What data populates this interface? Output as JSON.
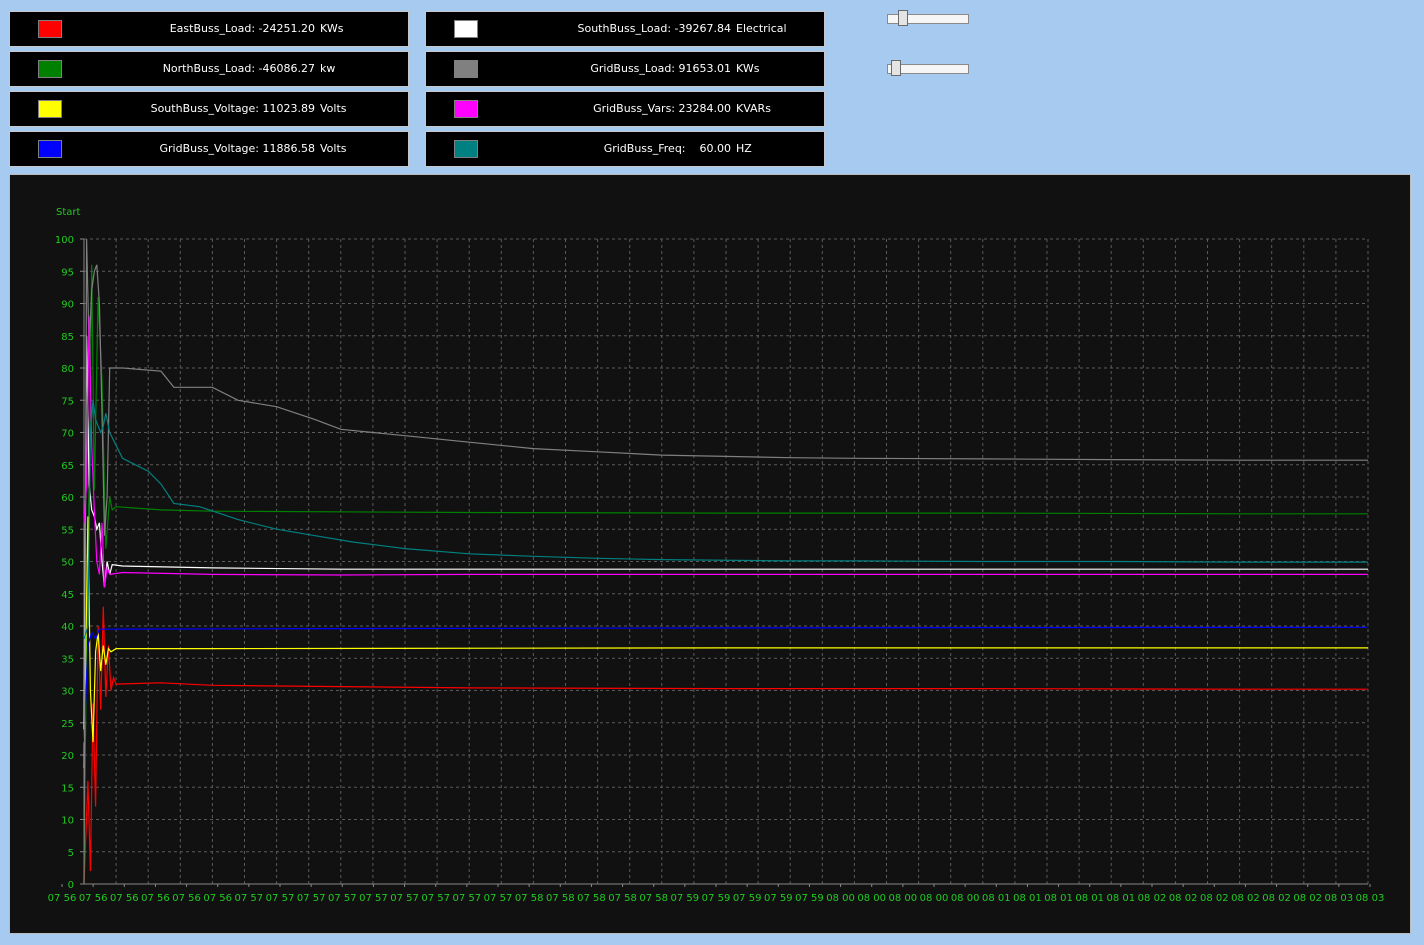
{
  "legend": [
    {
      "label": "EastBuss_Load: -24251.20",
      "unit": "KWs",
      "color": "#ff0000"
    },
    {
      "label": "NorthBuss_Load: -46086.27",
      "unit": "kw",
      "color": "#008000"
    },
    {
      "label": "SouthBuss_Voltage: 11023.89",
      "unit": "Volts",
      "color": "#ffff00"
    },
    {
      "label": "GridBuss_Voltage: 11886.58",
      "unit": "Volts",
      "color": "#0000ff"
    },
    {
      "label": "SouthBuss_Load: -39267.84",
      "unit": "Electrical",
      "color": "#ffffff"
    },
    {
      "label": "GridBuss_Load: 91653.01",
      "unit": "KWs",
      "color": "#808080"
    },
    {
      "label": "GridBuss_Vars: 23284.00",
      "unit": "KVARs",
      "color": "#ff00ff"
    },
    {
      "label": "GridBuss_Freq:    60.00",
      "unit": "HZ",
      "color": "#008080"
    }
  ],
  "sliders": [
    {
      "value": 0.15
    },
    {
      "value": 0.06
    }
  ],
  "chart_data": {
    "type": "line",
    "annotation": "Start",
    "ylim": [
      0,
      100
    ],
    "yticks": [
      0,
      5,
      10,
      15,
      20,
      25,
      30,
      35,
      40,
      45,
      50,
      55,
      60,
      65,
      70,
      75,
      80,
      85,
      90,
      95,
      100
    ],
    "grid": true,
    "xlim": [
      0,
      1
    ],
    "xticks": [
      {
        "x": 0.0,
        "label": "07 56"
      },
      {
        "x": 0.0205,
        "label": "07 56"
      },
      {
        "x": 0.0466,
        "label": "07 56"
      },
      {
        "x": 0.0729,
        "label": "07 56"
      },
      {
        "x": 0.0995,
        "label": "07 56"
      },
      {
        "x": 0.1256,
        "label": "07 56"
      },
      {
        "x": 0.1528,
        "label": "07 57"
      },
      {
        "x": 0.1787,
        "label": "07 57"
      },
      {
        "x": 0.2034,
        "label": "07 57"
      },
      {
        "x": 0.2274,
        "label": "07 57"
      },
      {
        "x": 0.2528,
        "label": "07 57"
      },
      {
        "x": 0.259,
        "label": "07 57"
      },
      {
        "x": 0.3134,
        "label": "07 57"
      },
      {
        "x": 0.3232,
        "label": "07 57"
      },
      {
        "x": 0.3472,
        "label": "07 57"
      },
      {
        "x": 0.3743,
        "label": "07 58"
      },
      {
        "x": 0.4006,
        "label": "07 58"
      },
      {
        "x": 0.4263,
        "label": "07 58"
      },
      {
        "x": 0.4827,
        "label": "07 58"
      },
      {
        "x": 0.5087,
        "label": "07 58"
      },
      {
        "x": 0.5354,
        "label": "07 59"
      },
      {
        "x": 0.5624,
        "label": "07 59"
      },
      {
        "x": 0.6156,
        "label": "07 59"
      },
      {
        "x": 0.6419,
        "label": "07 59"
      },
      {
        "x": 0.6681,
        "label": "07 59"
      },
      {
        "x": 0.695,
        "label": "08 00"
      },
      {
        "x": 0.7207,
        "label": "08 00"
      },
      {
        "x": 0.7467,
        "label": "08 00"
      },
      {
        "x": 0.7728,
        "label": "08 00"
      },
      {
        "x": 0.7991,
        "label": "08 00"
      },
      {
        "x": 0.8241,
        "label": "08 01"
      },
      {
        "x": 0.8482,
        "label": "08 01"
      },
      {
        "x": 0.8714,
        "label": "08 01"
      },
      {
        "x": 0.923,
        "label": "08 01"
      },
      {
        "x": 0.9476,
        "label": "08 01"
      },
      {
        "x": 0.9717,
        "label": "08 02"
      },
      {
        "x": 0.9972,
        "label": "08 02"
      },
      {
        "x": 1.022,
        "label": "08 02"
      },
      {
        "x": 1.0462,
        "label": "08 02"
      },
      {
        "x": 1.1012,
        "label": "08 02"
      },
      {
        "x": 1.1255,
        "label": "08 02"
      },
      {
        "x": 1.15,
        "label": "08 03"
      },
      {
        "x": 1.1741,
        "label": "08 03"
      }
    ],
    "series": [
      {
        "name": "EastBuss_Load",
        "color": "#ff0000",
        "points": [
          [
            0,
            0
          ],
          [
            0.003,
            16
          ],
          [
            0.005,
            2
          ],
          [
            0.007,
            28
          ],
          [
            0.009,
            12
          ],
          [
            0.011,
            40
          ],
          [
            0.013,
            27
          ],
          [
            0.015,
            43
          ],
          [
            0.017,
            29
          ],
          [
            0.019,
            37
          ],
          [
            0.021,
            30
          ],
          [
            0.023,
            32
          ],
          [
            0.025,
            31
          ],
          [
            0.06,
            31.2
          ],
          [
            0.1,
            30.8
          ],
          [
            0.2,
            30.6
          ],
          [
            0.3,
            30.4
          ],
          [
            0.5,
            30.3
          ],
          [
            0.7,
            30.3
          ],
          [
            0.9,
            30.2
          ],
          [
            1,
            30.2
          ]
        ]
      },
      {
        "name": "NorthBuss_Load",
        "color": "#008000",
        "points": [
          [
            0,
            0
          ],
          [
            0.002,
            40
          ],
          [
            0.004,
            62
          ],
          [
            0.006,
            96
          ],
          [
            0.008,
            61
          ],
          [
            0.011,
            91
          ],
          [
            0.014,
            78
          ],
          [
            0.017,
            52
          ],
          [
            0.02,
            60
          ],
          [
            0.022,
            58
          ],
          [
            0.025,
            58.5
          ],
          [
            0.06,
            58
          ],
          [
            0.1,
            57.8
          ],
          [
            0.3,
            57.6
          ],
          [
            0.5,
            57.5
          ],
          [
            0.7,
            57.5
          ],
          [
            0.9,
            57.4
          ],
          [
            1,
            57.4
          ]
        ]
      },
      {
        "name": "SouthBuss_Voltage",
        "color": "#ffff00",
        "points": [
          [
            0,
            18
          ],
          [
            0.003,
            57
          ],
          [
            0.005,
            30
          ],
          [
            0.007,
            22
          ],
          [
            0.009,
            36
          ],
          [
            0.011,
            39
          ],
          [
            0.013,
            33
          ],
          [
            0.015,
            37
          ],
          [
            0.017,
            34
          ],
          [
            0.019,
            36.5
          ],
          [
            0.021,
            36
          ],
          [
            0.025,
            36.5
          ],
          [
            0.1,
            36.5
          ],
          [
            0.5,
            36.6
          ],
          [
            1,
            36.6
          ]
        ]
      },
      {
        "name": "GridBuss_Voltage",
        "color": "#0000ff",
        "points": [
          [
            0,
            22
          ],
          [
            0.003,
            37
          ],
          [
            0.006,
            39
          ],
          [
            0.009,
            38
          ],
          [
            0.012,
            39.5
          ],
          [
            0.02,
            39.5
          ],
          [
            0.2,
            39.6
          ],
          [
            0.5,
            39.7
          ],
          [
            1,
            39.8
          ]
        ]
      },
      {
        "name": "SouthBuss_Load",
        "color": "#ffffff",
        "points": [
          [
            0,
            24
          ],
          [
            0.002,
            85
          ],
          [
            0.004,
            62
          ],
          [
            0.006,
            58
          ],
          [
            0.008,
            57
          ],
          [
            0.01,
            55
          ],
          [
            0.012,
            56
          ],
          [
            0.014,
            50
          ],
          [
            0.016,
            46
          ],
          [
            0.018,
            50
          ],
          [
            0.02,
            48
          ],
          [
            0.022,
            49.5
          ],
          [
            0.03,
            49.3
          ],
          [
            0.1,
            49
          ],
          [
            0.2,
            48.8
          ],
          [
            0.4,
            48.8
          ],
          [
            0.7,
            48.8
          ],
          [
            0.9,
            48.8
          ],
          [
            1,
            48.8
          ]
        ]
      },
      {
        "name": "GridBuss_Load",
        "color": "#808080",
        "points": [
          [
            0,
            0
          ],
          [
            0.002,
            100
          ],
          [
            0.004,
            83
          ],
          [
            0.006,
            92
          ],
          [
            0.008,
            95
          ],
          [
            0.01,
            96
          ],
          [
            0.012,
            90
          ],
          [
            0.014,
            73
          ],
          [
            0.016,
            54
          ],
          [
            0.018,
            60
          ],
          [
            0.02,
            80
          ],
          [
            0.03,
            80
          ],
          [
            0.06,
            79.5
          ],
          [
            0.07,
            77
          ],
          [
            0.1,
            77
          ],
          [
            0.12,
            75
          ],
          [
            0.15,
            74
          ],
          [
            0.18,
            72
          ],
          [
            0.2,
            70.5
          ],
          [
            0.25,
            69.5
          ],
          [
            0.3,
            68.5
          ],
          [
            0.35,
            67.5
          ],
          [
            0.4,
            67
          ],
          [
            0.45,
            66.5
          ],
          [
            0.5,
            66.3
          ],
          [
            0.55,
            66.1
          ],
          [
            0.6,
            66
          ],
          [
            0.7,
            65.9
          ],
          [
            0.8,
            65.8
          ],
          [
            0.9,
            65.7
          ],
          [
            1,
            65.7
          ]
        ]
      },
      {
        "name": "GridBuss_Vars",
        "color": "#ff00ff",
        "points": [
          [
            0,
            56
          ],
          [
            0.002,
            62
          ],
          [
            0.004,
            88
          ],
          [
            0.006,
            68
          ],
          [
            0.008,
            58
          ],
          [
            0.01,
            50
          ],
          [
            0.012,
            48
          ],
          [
            0.014,
            56
          ],
          [
            0.016,
            46
          ],
          [
            0.018,
            49
          ],
          [
            0.02,
            48
          ],
          [
            0.03,
            48.3
          ],
          [
            0.1,
            48
          ],
          [
            0.2,
            47.9
          ],
          [
            0.3,
            48
          ],
          [
            0.5,
            48
          ],
          [
            0.7,
            48
          ],
          [
            1,
            48
          ]
        ]
      },
      {
        "name": "GridBuss_Freq",
        "color": "#008080",
        "points": [
          [
            0,
            38
          ],
          [
            0.003,
            40
          ],
          [
            0.005,
            70
          ],
          [
            0.007,
            75
          ],
          [
            0.009,
            72
          ],
          [
            0.011,
            71
          ],
          [
            0.013,
            70
          ],
          [
            0.015,
            71
          ],
          [
            0.017,
            73
          ],
          [
            0.02,
            70
          ],
          [
            0.03,
            66
          ],
          [
            0.05,
            64
          ],
          [
            0.06,
            62
          ],
          [
            0.07,
            59
          ],
          [
            0.09,
            58.5
          ],
          [
            0.12,
            56.5
          ],
          [
            0.15,
            55
          ],
          [
            0.18,
            54
          ],
          [
            0.21,
            53
          ],
          [
            0.25,
            52
          ],
          [
            0.3,
            51.2
          ],
          [
            0.35,
            50.8
          ],
          [
            0.4,
            50.5
          ],
          [
            0.45,
            50.3
          ],
          [
            0.55,
            50.1
          ],
          [
            0.6,
            50.1
          ],
          [
            0.7,
            50
          ],
          [
            0.8,
            50
          ],
          [
            0.9,
            49.9
          ],
          [
            1,
            49.9
          ]
        ]
      }
    ]
  }
}
